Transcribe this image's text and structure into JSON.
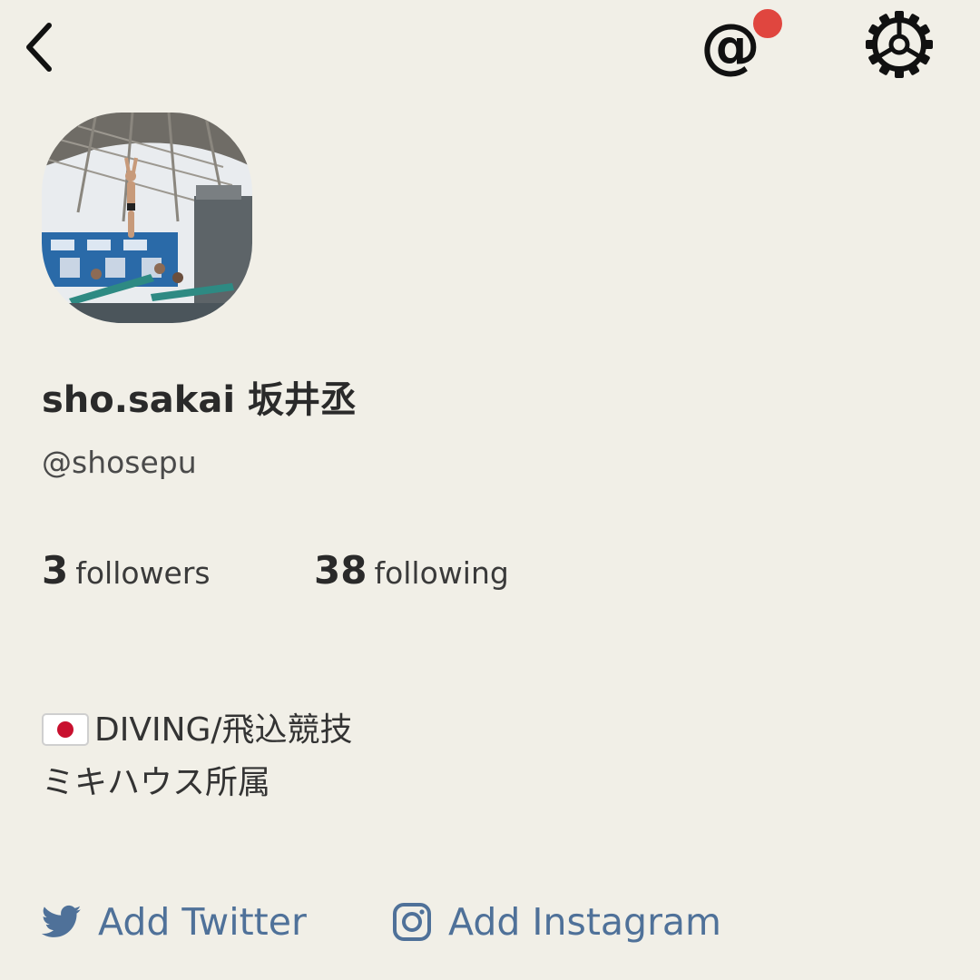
{
  "header": {
    "back_icon": "chevron-left-icon",
    "mentions_icon": "at-icon",
    "mentions_symbol": "@",
    "notification_color": "#e0463f",
    "settings_icon": "gear-icon"
  },
  "profile": {
    "display_name": "sho.sakai 坂井丞",
    "username": "@shosepu",
    "followers_count": "3",
    "followers_label": "followers",
    "following_count": "38",
    "following_label": "following",
    "bio_line1": "DIVING/飛込競技",
    "bio_line2": "ミキハウス所属",
    "bio_flag_icon": "japan-flag-icon"
  },
  "links": {
    "twitter_label": "Add Twitter",
    "instagram_label": "Add Instagram",
    "link_color": "#4f7199"
  },
  "colors": {
    "background": "#f1efe7",
    "text": "#2b2b2b"
  }
}
